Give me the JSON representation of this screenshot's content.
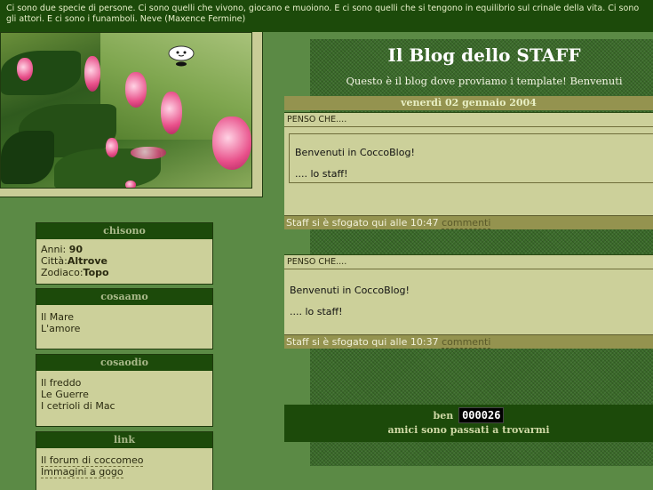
{
  "quote": "Ci sono due specie di persone. Ci sono quelli che vivono, giocano e muoiono. E ci sono quelli che si tengono in equilibrio sul crinale della vita. Ci sono gli attori. E ci sono i funamboli. Neve (Maxence Fermine)",
  "blog": {
    "title": "Il Blog dello STAFF",
    "description": "Questo è il blog dove proviamo i template! Benvenuti"
  },
  "date_header": "venerdì 02 gennaio 2004",
  "posts": [
    {
      "title": "PENSO CHE....",
      "lines": [
        "Benvenuti in CoccoBlog!",
        ".... lo staff!"
      ],
      "footer_prefix": "Staff si è sfogato qui alle 10:47",
      "comments_label": "commenti"
    },
    {
      "title": "PENSO CHE....",
      "lines": [
        "Benvenuti in CoccoBlog!",
        ".... lo staff!"
      ],
      "footer_prefix": "Staff si è sfogato qui alle 10:37",
      "comments_label": "commenti"
    }
  ],
  "counter": {
    "prefix": "ben",
    "digits": "000026",
    "suffix": "amici sono passati a trovarmi"
  },
  "sidebar": {
    "chisono": {
      "title": "chisono",
      "rows": [
        {
          "label": "Anni:",
          "value": "90"
        },
        {
          "label": "Città:",
          "value": "Altrove"
        },
        {
          "label": "Zodiaco:",
          "value": "Topo"
        }
      ]
    },
    "cosaamo": {
      "title": "cosaamo",
      "items": [
        "Il Mare",
        "L'amore"
      ]
    },
    "cosaodio": {
      "title": "cosaodio",
      "items": [
        "Il freddo",
        "Le Guerre",
        "I cetrioli di Mac"
      ]
    },
    "link": {
      "title": "link",
      "items": [
        "Il forum di coccomeo",
        "Immagini a gogo"
      ]
    }
  },
  "icons": {
    "mascot": "ghost-mascot-icon"
  }
}
